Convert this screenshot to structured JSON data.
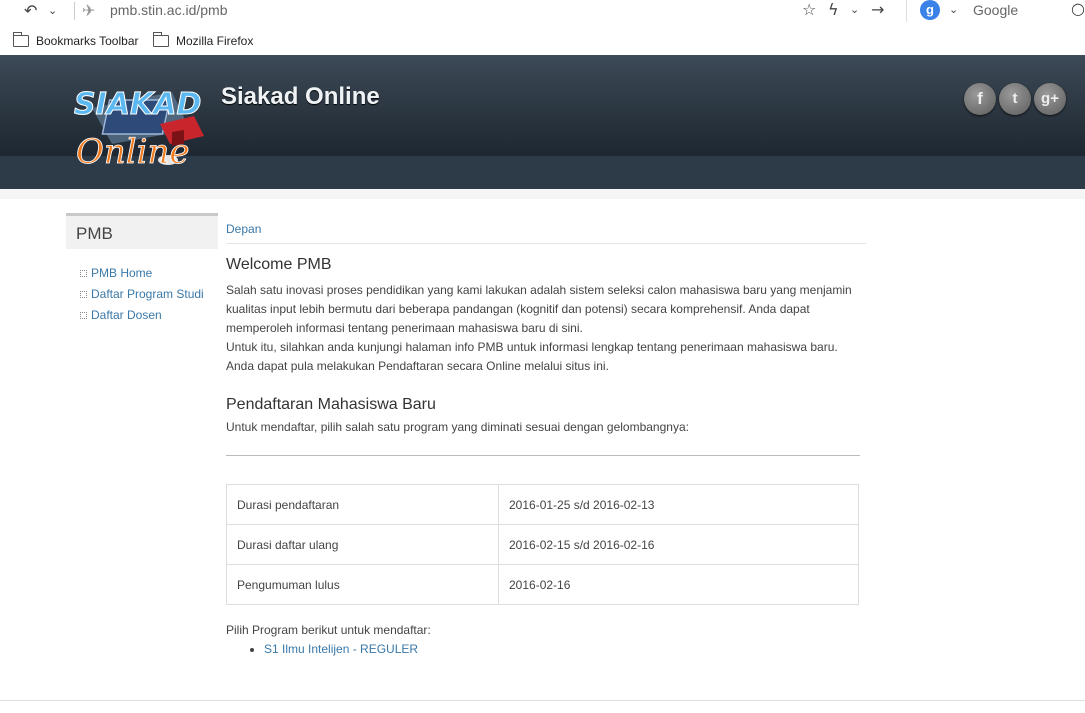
{
  "browser": {
    "url": "pmb.stin.ac.id/pmb",
    "search_engine": "Google",
    "bookmarks": [
      "Bookmarks Toolbar",
      "Mozilla Firefox"
    ]
  },
  "site": {
    "logo_top": "SIAKAD",
    "logo_bottom": "Online",
    "title": "Siakad Online",
    "social": [
      "f",
      "t",
      "g+"
    ]
  },
  "sidebar": {
    "title": "PMB",
    "items": [
      "PMB Home",
      "Daftar Program Studi",
      "Daftar Dosen"
    ]
  },
  "main": {
    "breadcrumb": "Depan",
    "welcome_title": "Welcome PMB",
    "welcome_p1": "Salah satu inovasi proses pendidikan yang kami lakukan adalah sistem seleksi calon mahasiswa baru yang menjamin kualitas input lebih bermutu dari beberapa pandangan (kognitif dan potensi) secara komprehensif. Anda dapat memperoleh informasi tentang penerimaan mahasiswa baru di sini.",
    "welcome_p2": "Untuk itu, silahkan anda kunjungi halaman info PMB untuk informasi lengkap tentang penerimaan mahasiswa baru. Anda dapat pula melakukan Pendaftaran secara Online melalui situs ini.",
    "reg_title": "Pendaftaran Mahasiswa Baru",
    "reg_intro": "Untuk mendaftar, pilih salah satu program yang diminati sesuai dengan gelombangnya:",
    "table": [
      {
        "label": "Durasi pendaftaran",
        "value": "2016-01-25 s/d 2016-02-13"
      },
      {
        "label": "Durasi daftar ulang",
        "value": "2016-02-15 s/d 2016-02-16"
      },
      {
        "label": "Pengumuman lulus",
        "value": "2016-02-16"
      }
    ],
    "choose_text": "Pilih Program berikut untuk mendaftar:",
    "programs": [
      "S1 Ilmu Intelijen - REGULER"
    ]
  }
}
